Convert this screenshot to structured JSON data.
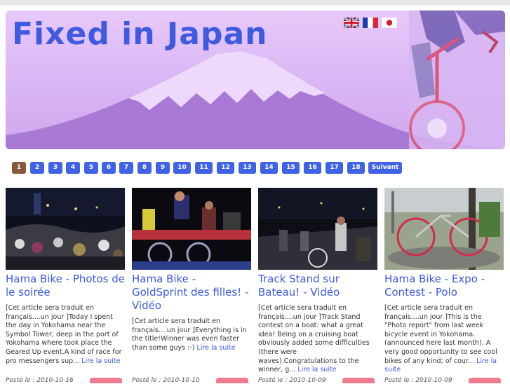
{
  "site": {
    "title": "Fixed in Japan"
  },
  "languages": [
    {
      "name": "english-flag-icon"
    },
    {
      "name": "french-flag-icon"
    },
    {
      "name": "japanese-flag-icon"
    }
  ],
  "pagination": {
    "current": "1",
    "pages": [
      "1",
      "2",
      "3",
      "4",
      "5",
      "6",
      "7",
      "8",
      "9",
      "10",
      "11",
      "12",
      "13",
      "14",
      "15",
      "16",
      "17",
      "18"
    ],
    "next_label": "Suivant"
  },
  "articles": [
    {
      "title": "Hama Bike - Photos de le soirée",
      "excerpt": "[Cet article sera traduit en français....un jour ]Today I spent the day in Yokohama near the Symbol Tower, deep in the port of Yokohama where took place the Geared Up event.A kind of race for pro messengers sup...",
      "read_more": "Lire la suite",
      "meta": "Posté le : 2010-10-16"
    },
    {
      "title": "Hama Bike - GoldSprint des filles! - Vidéo",
      "excerpt": "[Cet article sera traduit en français....un jour ]Everything is in the title!Winner was even faster than some guys :-)",
      "read_more": "Lire la suite",
      "meta": "Posté le : 2010-10-10"
    },
    {
      "title": "Track Stand sur Bateau! - Vidéo",
      "excerpt": "[Cet article sera traduit en français....un jour ]Track Stand contest on a boat: what a great idea! Being on a cruising boat obviously added some difficulties (there were waves).Congratulations to the winner, g...",
      "read_more": "Lire la suite",
      "meta": "Posté le : 2010-10-09"
    },
    {
      "title": "Hama Bike - Expo - Contest - Polo",
      "excerpt": "[Cet article sera traduit en français....un jour ]This is the \"Photo report\" from last week bicycle event in Yokohama. (announced here last month). A very good opportunity to see cool bikes of any kind; of cour...",
      "read_more": "Lire la suite",
      "meta": "Posté le : 2010-10-09"
    }
  ]
}
